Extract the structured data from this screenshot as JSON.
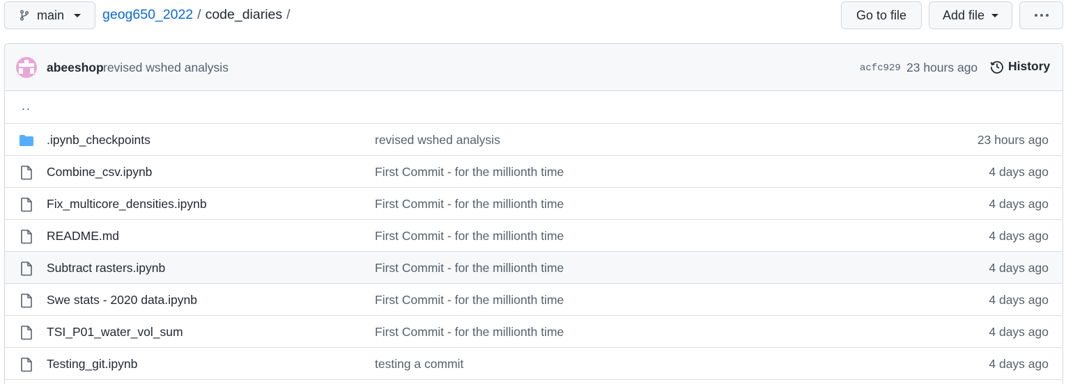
{
  "branch": {
    "label": "main"
  },
  "breadcrumb": {
    "repo": "geog650_2022",
    "separator": "/",
    "folder": "code_diaries",
    "trailing": "/"
  },
  "toolbar": {
    "go_to_file": "Go to file",
    "add_file": "Add file"
  },
  "latest_commit": {
    "author": "abeeshop",
    "message": "revised wshed analysis",
    "sha": "acfc929",
    "time": "23 hours ago",
    "history_label": "History"
  },
  "parent_dir": "..",
  "files": [
    {
      "type": "directory",
      "name": ".ipynb_checkpoints",
      "message": "revised wshed analysis",
      "time": "23 hours ago"
    },
    {
      "type": "file",
      "name": "Combine_csv.ipynb",
      "message": "First Commit - for the millionth time",
      "time": "4 days ago"
    },
    {
      "type": "file",
      "name": "Fix_multicore_densities.ipynb",
      "message": "First Commit - for the millionth time",
      "time": "4 days ago"
    },
    {
      "type": "file",
      "name": "README.md",
      "message": "First Commit - for the millionth time",
      "time": "4 days ago"
    },
    {
      "type": "file",
      "name": "Subtract rasters.ipynb",
      "message": "First Commit - for the millionth time",
      "time": "4 days ago"
    },
    {
      "type": "file",
      "name": "Swe stats - 2020 data.ipynb",
      "message": "First Commit - for the millionth time",
      "time": "4 days ago"
    },
    {
      "type": "file",
      "name": "TSI_P01_water_vol_sum",
      "message": "First Commit - for the millionth time",
      "time": "4 days ago"
    },
    {
      "type": "file",
      "name": "Testing_git.ipynb",
      "message": "testing a commit",
      "time": "4 days ago"
    }
  ],
  "icons": {
    "branch": "git-branch-icon",
    "history": "history-clock-icon",
    "folder": "folder-icon",
    "file": "file-icon",
    "more": "kebab-horizontal-icon"
  },
  "colors": {
    "link": "#0969da",
    "folder": "#54aeff",
    "avatar": "#e8a7d6",
    "muted": "#57606a",
    "border": "#d0d7de"
  }
}
